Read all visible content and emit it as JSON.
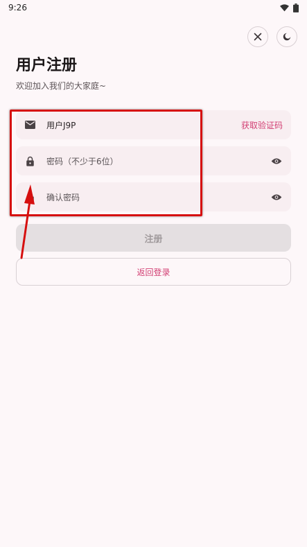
{
  "status_bar": {
    "time": "9:26"
  },
  "header": {
    "title": "用户注册",
    "subtitle": "欢迎加入我们的大家庭~"
  },
  "form": {
    "email": {
      "value": "用户J9P",
      "action_label": "获取验证码",
      "icon": "mail-icon"
    },
    "password": {
      "placeholder": "密码（不少于6位）",
      "icon": "lock-icon"
    },
    "confirm_password": {
      "placeholder": "确认密码",
      "icon": "lock-icon"
    }
  },
  "buttons": {
    "register_label": "注册",
    "back_label": "返回登录"
  },
  "colors": {
    "background": "#fdf7f9",
    "field_bg": "#f8eef1",
    "accent": "#d23f73",
    "disabled_btn": "#e4dfe1",
    "annotation": "#d60f0f"
  }
}
